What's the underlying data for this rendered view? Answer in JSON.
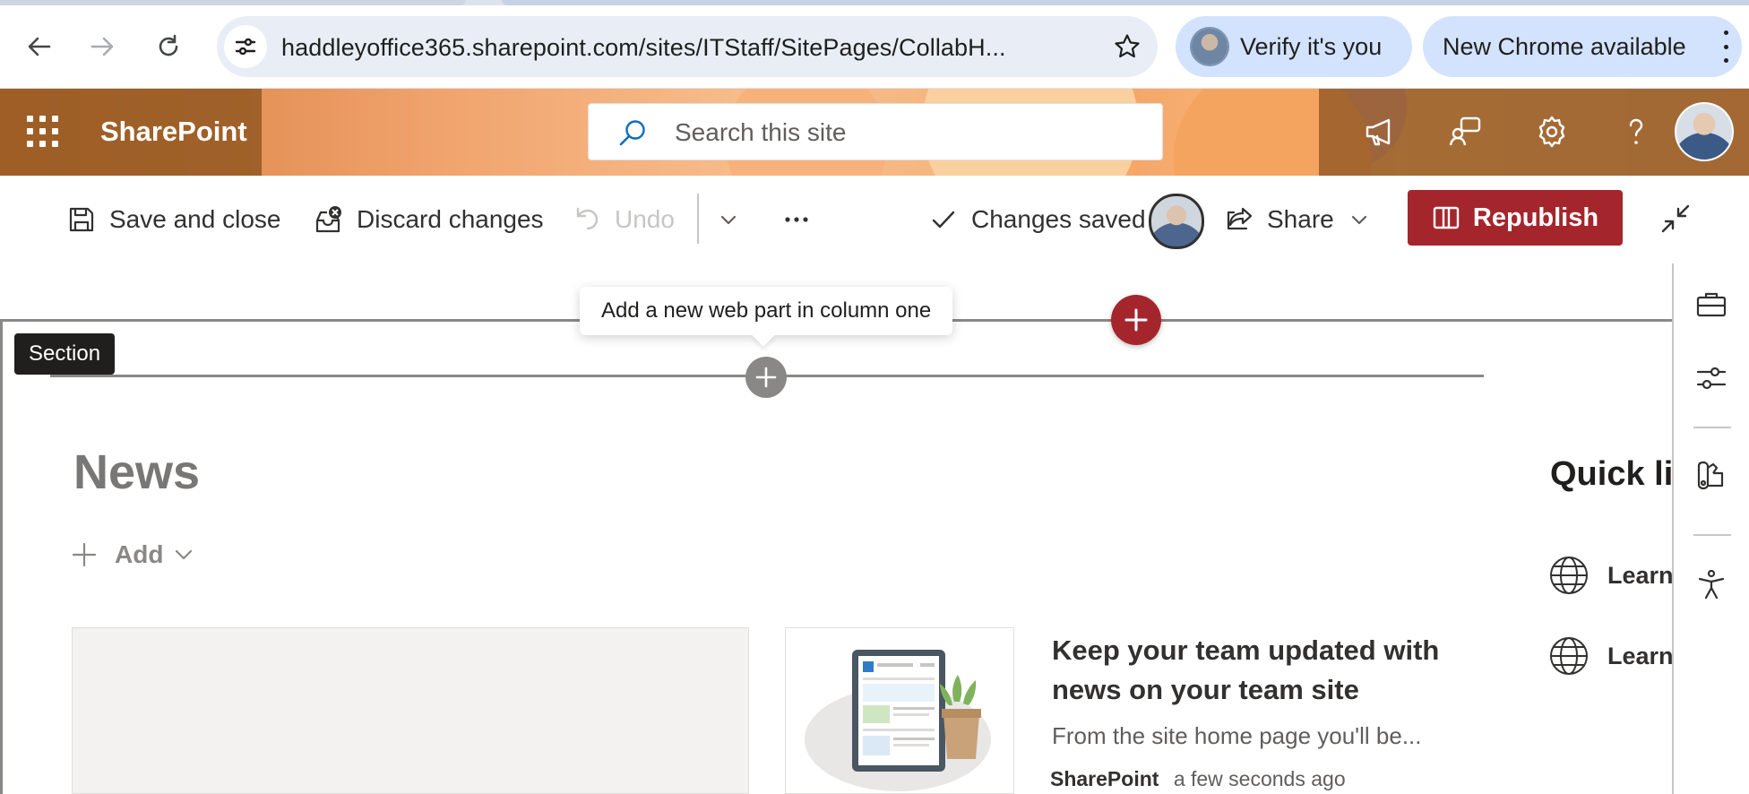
{
  "browser": {
    "url": "haddleyoffice365.sharepoint.com/sites/ITStaff/SitePages/CollabH...",
    "verify_label": "Verify it's you",
    "update_label": "New Chrome available"
  },
  "suite": {
    "brand": "SharePoint",
    "search_placeholder": "Search this site",
    "icons": [
      "waffle-icon",
      "megaphone-icon",
      "feedback-icon",
      "gear-icon",
      "help-icon"
    ]
  },
  "command_bar": {
    "save_close": "Save and close",
    "discard": "Discard changes",
    "undo": "Undo",
    "status": "Changes saved",
    "share": "Share",
    "republish": "Republish"
  },
  "canvas": {
    "tooltip": "Add a new web part in column one",
    "section_label": "Section"
  },
  "news": {
    "title": "News",
    "add_label": "Add",
    "headline": "Keep your team updated with news on your team site",
    "description": "From the site home page you'll be...",
    "source": "SharePoint",
    "time": "a few seconds ago"
  },
  "quick_links": {
    "title": "Quick li",
    "items": [
      {
        "label": "Learn"
      },
      {
        "label": "Learn"
      }
    ]
  },
  "colors": {
    "accent_red": "#a4262c",
    "suite_brown": "#965a23",
    "chrome_pill": "#d3e3fd"
  }
}
